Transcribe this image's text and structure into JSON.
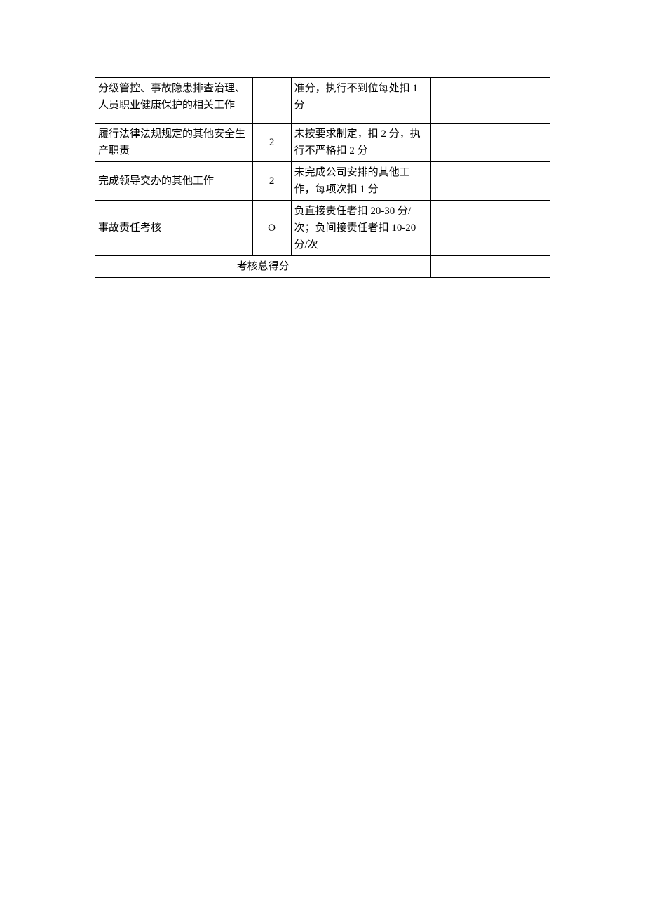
{
  "table": {
    "rows": [
      {
        "item": "分级管控、事故隐患排查治理、人员职业健康保护的相关工作",
        "score": "",
        "criteria": "准分，执行不到位每处扣 1分"
      },
      {
        "item": "履行法律法规规定的其他安全生产职责",
        "score": "2",
        "criteria": "未按要求制定，扣 2 分，执行不严格扣 2 分"
      },
      {
        "item": "完成领导交办的其他工作",
        "score": "2",
        "criteria": "未完成公司安排的其他工作，每项次扣 1 分"
      },
      {
        "item": "事故责任考核",
        "score": "O",
        "criteria": "负直接责任者扣 20-30 分/次；负间接责任者扣 10-20分/次"
      }
    ],
    "footer_label": "考核总得分"
  }
}
